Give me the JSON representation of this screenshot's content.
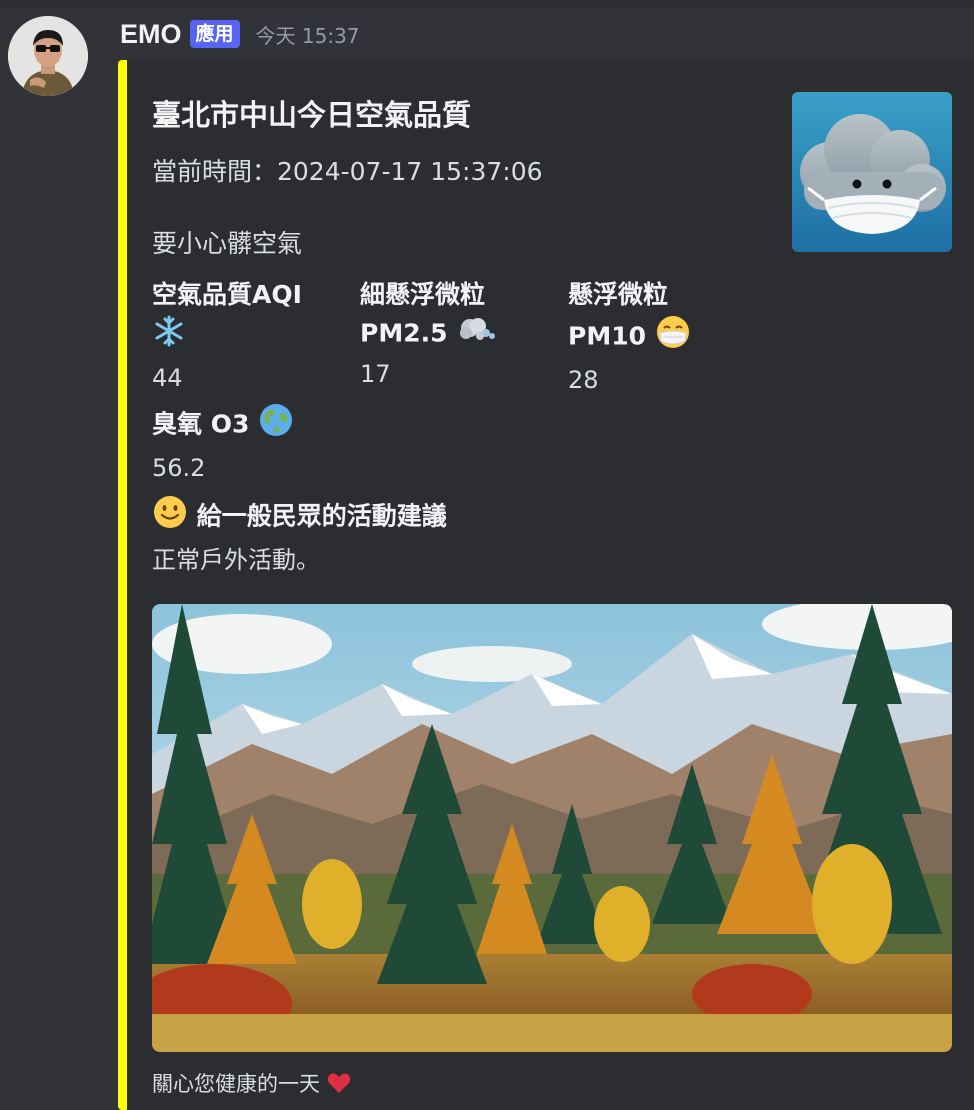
{
  "message": {
    "username": "EMO",
    "app_badge": "應用",
    "timestamp": "今天 15:37"
  },
  "embed": {
    "accent_color": "#ffff00",
    "title": "臺北市中山今日空氣品質",
    "current_time": "當前時間：2024-07-17 15:37:06",
    "description": "要小心髒空氣",
    "fields": {
      "aqi": {
        "name": "空氣品質AQI",
        "icon": "snowflake-icon",
        "value": "44"
      },
      "pm25": {
        "name_line1": "細懸浮微粒",
        "name_line2": "PM2.5",
        "icon": "dash-icon",
        "value": "17"
      },
      "pm10": {
        "name_line1": "懸浮微粒",
        "name_line2": "PM10",
        "icon": "mask-face-icon",
        "value": "28"
      },
      "o3": {
        "name": "臭氧 O3",
        "icon": "globe-icon",
        "value": "56.2"
      },
      "advice": {
        "icon": "smile-face-icon",
        "name": "給一般民眾的活動建議",
        "value": "正常戶外活動。"
      }
    },
    "thumbnail_icon": "masked-cloud-icon",
    "image_description_icon": "mountain-forest-image",
    "footer": "關心您健康的一天",
    "footer_icon": "heart-icon"
  }
}
